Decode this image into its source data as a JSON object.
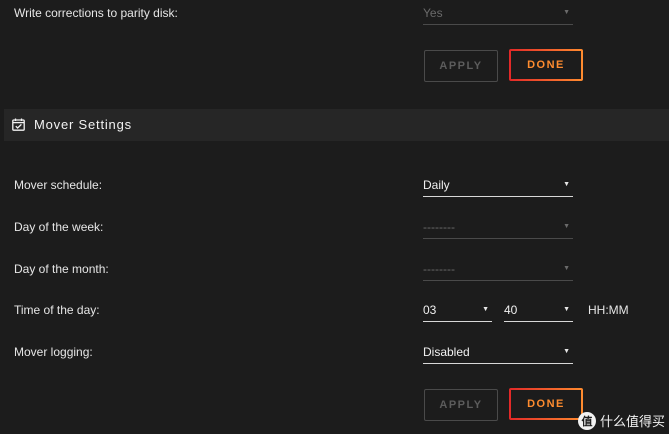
{
  "parity": {
    "label": "Write corrections to parity disk:",
    "value": "Yes",
    "apply_label": "APPLY",
    "done_label": "DONE"
  },
  "mover": {
    "section_title": "Mover Settings",
    "section_icon": "calendar-check-icon",
    "schedule_label": "Mover schedule:",
    "schedule_value": "Daily",
    "weekday_label": "Day of the week:",
    "weekday_value": "--------",
    "monthday_label": "Day of the month:",
    "monthday_value": "--------",
    "time_label": "Time of the day:",
    "hour_value": "03",
    "minute_value": "40",
    "time_format": "HH:MM",
    "logging_label": "Mover logging:",
    "logging_value": "Disabled",
    "apply_label": "APPLY",
    "done_label": "DONE"
  },
  "watermark": {
    "logo_char": "值",
    "text": "什么值得买"
  },
  "colors": {
    "background": "#1c1c1c",
    "section_bar": "#262626",
    "accent_orange": "#ff8c2f",
    "accent_red": "#e22828"
  }
}
